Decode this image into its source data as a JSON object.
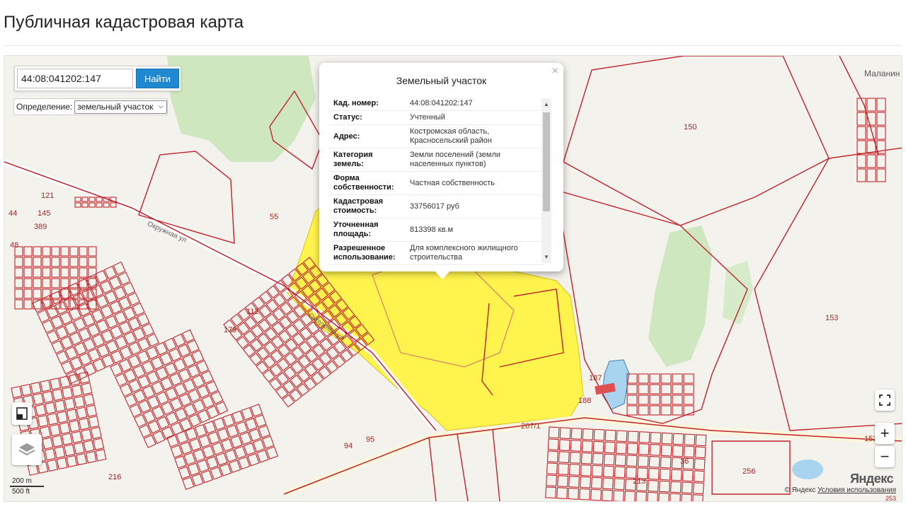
{
  "page": {
    "title": "Публичная кадастровая карта"
  },
  "search": {
    "value": "44:08:041202:147",
    "button_label": "Найти"
  },
  "definition": {
    "label": "Определение:",
    "selected": "земельный участок"
  },
  "popup": {
    "title": "Земельный участок",
    "close_glyph": "×",
    "rows": [
      {
        "key": "Кад. номер:",
        "value": "44:08:041202:147"
      },
      {
        "key": "Статус:",
        "value": "Учтенный"
      },
      {
        "key": "Адрес:",
        "value": "Костромская область, Красносельский район"
      },
      {
        "key": "Категория земель:",
        "value": "Земли поселений (земли населенных пунктов)"
      },
      {
        "key": "Форма собственности:",
        "value": "Частная собственность"
      },
      {
        "key": "Кадастровая стоимость:",
        "value": "33756017 руб"
      },
      {
        "key": "Уточненная площадь:",
        "value": "813398 кв.м"
      },
      {
        "key": "Разрешенное использование:",
        "value": "Для комплексного жилищного строительства"
      }
    ]
  },
  "map": {
    "parcel_labels": [
      "55",
      "150",
      "153",
      "121",
      "145",
      "389",
      "44",
      "48",
      "112",
      "179",
      "94",
      "95",
      "187",
      "188",
      "207/1",
      "256",
      "213",
      "36",
      "216",
      "153",
      "253"
    ],
    "street_labels": [
      "Окружная ул",
      "Окружная ул"
    ],
    "place_label": "Маланин",
    "highlight_color": "#fff34d",
    "parcel_line_color": "#c0232b",
    "forest_color": "#c8e6b4",
    "water_color": "#a8d4f0"
  },
  "controls": {
    "zoom_in": "+",
    "zoom_out": "−",
    "scale_metric": "200 m",
    "scale_imperial": "500 ft",
    "yandex_logo": "Яндекс",
    "copyright": "© Яндекс",
    "terms": "Условия использования"
  }
}
